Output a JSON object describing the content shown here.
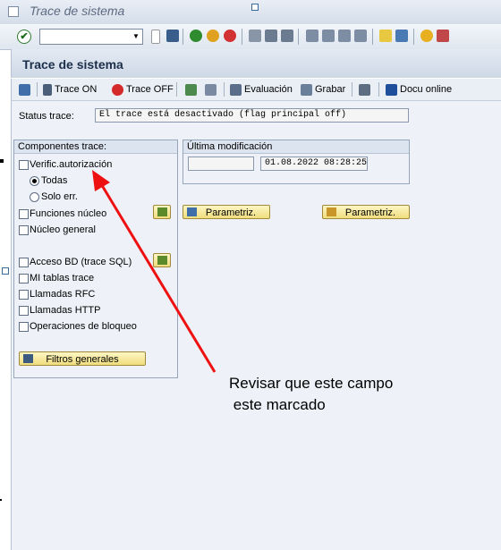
{
  "window": {
    "title": "Trace de sistema"
  },
  "toolbar": {
    "command_value": ""
  },
  "header": {
    "title": "Trace de sistema"
  },
  "app_toolbar": {
    "trace_on": "Trace ON",
    "trace_off": "Trace OFF",
    "evaluacion": "Evaluación",
    "grabar": "Grabar",
    "docu_online": "Docu online"
  },
  "status": {
    "label": "Status trace:",
    "value": "El trace está desactivado (flag principal off)"
  },
  "componentes": {
    "title": "Componentes trace:",
    "verific": "Verific.autorización",
    "todas": "Todas",
    "solo_err": "Solo err.",
    "funciones": "Funciones núcleo",
    "nucleo": "Núcleo general",
    "acceso_bd": "Acceso BD (trace SQL)",
    "mi_tablas": "MI tablas trace",
    "llamadas_rfc": "Llamadas RFC",
    "llamadas_http": "Llamadas HTTP",
    "operaciones": "Operaciones de bloqueo",
    "filtros": "Filtros generales"
  },
  "ultima": {
    "title": "Última modificación",
    "user": "",
    "datetime": "01.08.2022 08:28:25"
  },
  "buttons": {
    "parametriz_1": "Parametriz.",
    "parametriz_2": "Parametriz."
  },
  "annotation": {
    "line1": "Revisar que este campo",
    "line2": "este marcado"
  },
  "colors": {
    "annotation_arrow": "#ee1111",
    "header_bg": "#cdd8e6",
    "button_bg": "#f0dd7e"
  }
}
